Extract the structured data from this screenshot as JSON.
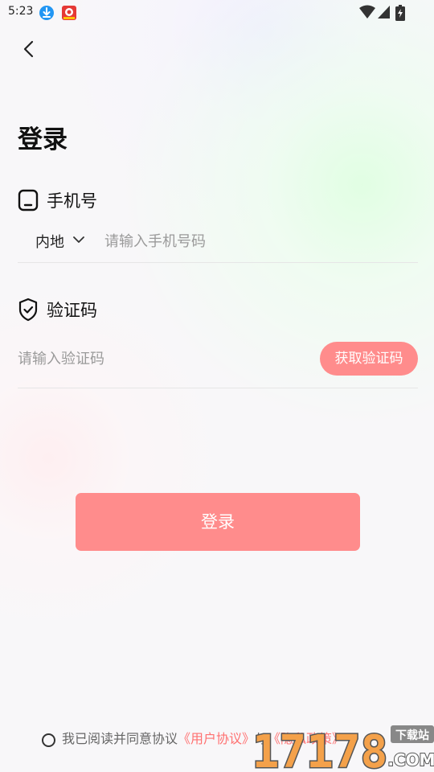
{
  "status_bar": {
    "time": "5:23"
  },
  "page": {
    "title": "登录"
  },
  "phone": {
    "label": "手机号",
    "region": "内地",
    "placeholder": "请输入手机号码"
  },
  "code": {
    "label": "验证码",
    "placeholder": "请输入验证码",
    "get_code_label": "获取验证码"
  },
  "login_button_label": "登录",
  "agreement": {
    "prefix": "我已阅读并同意协议",
    "user_agreement": "《用户协议》",
    "and": "与",
    "privacy_policy": "《隐私政策》"
  },
  "watermark": {
    "text": "17178",
    "tag": "下载站",
    "domain": ".COM"
  },
  "colors": {
    "accent": "#ff8c8c",
    "link": "#ff7070"
  }
}
